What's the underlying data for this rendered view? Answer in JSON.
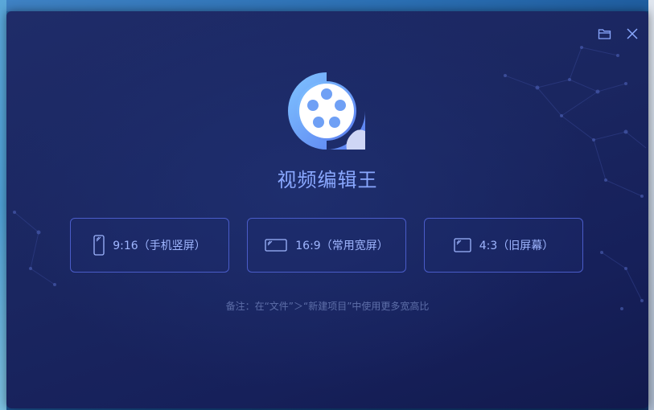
{
  "app": {
    "title": "视频编辑王"
  },
  "toolbar": {
    "open_folder_icon": "folder-open-icon",
    "close_icon": "close-icon"
  },
  "ratios": [
    {
      "label": "9:16（手机竖屏）",
      "icon": "portrait-screen-icon"
    },
    {
      "label": "16:9（常用宽屏）",
      "icon": "widescreen-icon"
    },
    {
      "label": "4:3（旧屏幕）",
      "icon": "standard-screen-icon"
    }
  ],
  "note": "备注：在“文件”＞“新建项目”中使用更多宽高比",
  "colors": {
    "accent": "#8aa8ff",
    "border": "#4a5cc8",
    "background": "#1a2660"
  }
}
